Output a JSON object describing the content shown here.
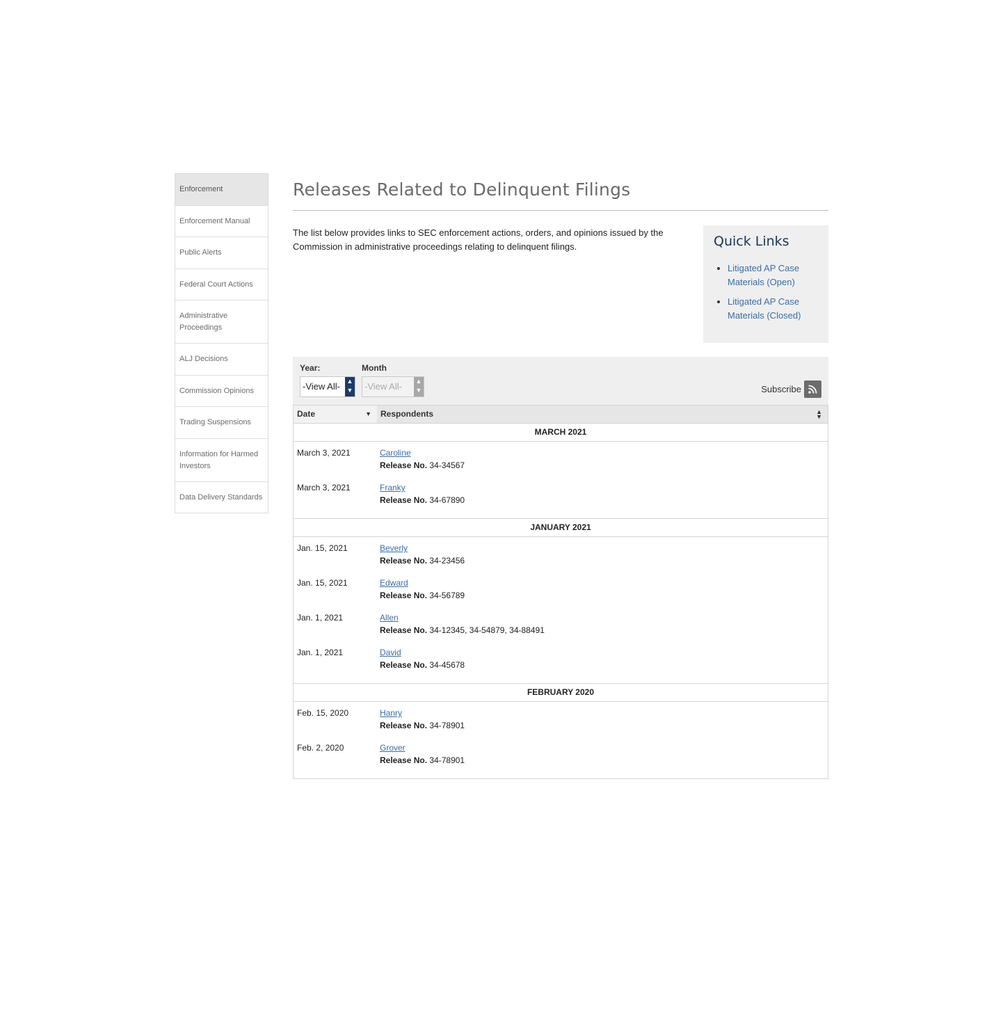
{
  "sidebar": {
    "items": [
      {
        "label": "Enforcement",
        "active": true
      },
      {
        "label": "Enforcement Manual"
      },
      {
        "label": "Public Alerts"
      },
      {
        "label": "Federal Court Actions"
      },
      {
        "label": "Administrative Proceedings"
      },
      {
        "label": "ALJ Decisions"
      },
      {
        "label": "Commission Opinions"
      },
      {
        "label": "Trading Suspensions"
      },
      {
        "label": "Information for Harmed Investors"
      },
      {
        "label": "Data Delivery Standards"
      }
    ]
  },
  "page": {
    "title": "Releases Related to Delinquent Filings",
    "intro": "The list below provides links to SEC enforcement actions, orders, and opinions issued by the Commission in administrative proceedings relating to delinquent filings."
  },
  "quick_links": {
    "heading": "Quick Links",
    "links": [
      {
        "label": "Litigated AP Case Materials (Open)"
      },
      {
        "label": "Litigated AP Case Materials (Closed)"
      }
    ]
  },
  "filters": {
    "year_label": "Year:",
    "year_value": "-View All-",
    "month_label": "Month",
    "month_value": "-View All-",
    "subscribe_label": "Subscribe"
  },
  "table": {
    "headers": {
      "date": "Date",
      "respondents": "Respondents"
    },
    "release_label": "Release No.",
    "groups": [
      {
        "heading": "MARCH 2021",
        "rows": [
          {
            "date": "March 3, 2021",
            "name": "Caroline",
            "release": "34-34567"
          },
          {
            "date": "March 3, 2021",
            "name": "Franky",
            "release": "34-67890"
          }
        ]
      },
      {
        "heading": "JANUARY 2021",
        "rows": [
          {
            "date": "Jan. 15, 2021",
            "name": "Beverly",
            "release": "34-23456"
          },
          {
            "date": "Jan. 15, 2021",
            "name": "Edward",
            "release": "34-56789"
          },
          {
            "date": "Jan. 1, 2021",
            "name": "Allen",
            "release": "34-12345, 34-54879, 34-88491"
          },
          {
            "date": "Jan. 1, 2021",
            "name": "David",
            "release": "34-45678"
          }
        ]
      },
      {
        "heading": "FEBRUARY 2020",
        "rows": [
          {
            "date": "Feb. 15, 2020",
            "name": "Hanry",
            "release": "34-78901"
          },
          {
            "date": "Feb. 2, 2020",
            "name": "Grover",
            "release": "34-78901"
          }
        ]
      }
    ]
  }
}
